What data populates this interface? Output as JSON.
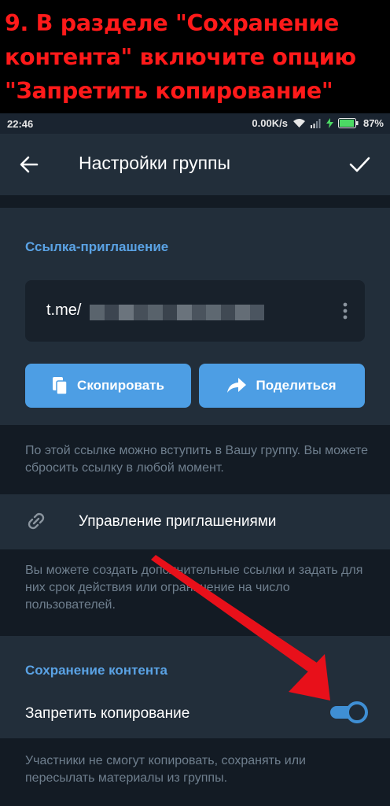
{
  "banner": {
    "lines": [
      "9. В разделе \"Сохранение",
      "контента\" включите опцию",
      "\"Запретить копирование\""
    ]
  },
  "status_bar": {
    "time": "22:46",
    "speed": "0.00K/s",
    "battery": "87%"
  },
  "app_bar": {
    "title": "Настройки группы",
    "back_icon": "arrow-left-icon",
    "confirm_icon": "checkmark-icon"
  },
  "invite": {
    "section_title": "Ссылка-приглашение",
    "link_prefix": "t.me/",
    "copy_label": "Скопировать",
    "share_label": "Поделиться",
    "info": "По этой ссылке можно вступить в Вашу группу. Вы можете сбросить ссылку в любой момент."
  },
  "manage": {
    "label": "Управление приглашениями",
    "info": "Вы можете создать дополнительные ссылки и задать для них срок действия или ограничение на число пользователей."
  },
  "content_saving": {
    "section_title": "Сохранение контента",
    "toggle_label": "Запретить копирование",
    "toggle_on": true,
    "info": "Участники не смогут копировать, сохранять или пересылать материалы из группы."
  },
  "colors": {
    "banner_text": "#ff1a1a",
    "background": "#18222d",
    "card": "#222e3a",
    "accent": "#4d9ee4",
    "section_title": "#5aa2e4",
    "muted_text": "#6f7f8e",
    "annotation_arrow": "#e8101a"
  }
}
